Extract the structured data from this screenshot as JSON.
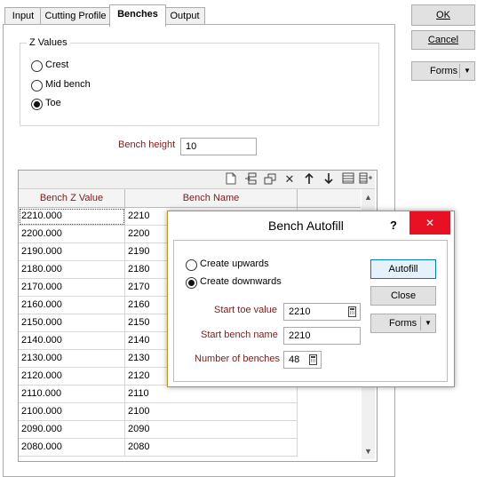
{
  "tabs": [
    "Input",
    "Cutting Profile",
    "Benches",
    "Output"
  ],
  "z_values": {
    "title": "Z Values",
    "options": [
      "Crest",
      "Mid bench",
      "Toe"
    ],
    "selected": "Toe"
  },
  "bench_height": {
    "label": "Bench height",
    "value": "10"
  },
  "grid": {
    "columns": [
      "Bench Z Value",
      "Bench Name"
    ],
    "rows": [
      [
        "2210.000",
        "2210"
      ],
      [
        "2200.000",
        "2200"
      ],
      [
        "2190.000",
        "2190"
      ],
      [
        "2180.000",
        "2180"
      ],
      [
        "2170.000",
        "2170"
      ],
      [
        "2160.000",
        "2160"
      ],
      [
        "2150.000",
        "2150"
      ],
      [
        "2140.000",
        "2140"
      ],
      [
        "2130.000",
        "2130"
      ],
      [
        "2120.000",
        "2120"
      ],
      [
        "2110.000",
        "2110"
      ],
      [
        "2100.000",
        "2100"
      ],
      [
        "2090.000",
        "2090"
      ],
      [
        "2080.000",
        "2080"
      ]
    ],
    "toolbar_icons": [
      "new-row-icon",
      "insert-row-icon",
      "copy-row-icon",
      "delete-row-icon",
      "move-up-icon",
      "move-down-icon",
      "table-icon",
      "add-column-icon"
    ]
  },
  "buttons": {
    "ok": "OK",
    "cancel": "Cancel",
    "forms": "Forms"
  },
  "dialog": {
    "title": "Bench Autofill",
    "help": "?",
    "close": "✕",
    "options": [
      "Create upwards",
      "Create downwards"
    ],
    "selected": "Create downwards",
    "fields": {
      "start_toe_label": "Start toe value",
      "start_toe_value": "2210",
      "start_bench_label": "Start bench name",
      "start_bench_value": "2210",
      "num_benches_label": "Number of benches",
      "num_benches_value": "48"
    },
    "buttons": {
      "autofill": "Autofill",
      "close": "Close",
      "forms": "Forms"
    }
  },
  "colors": {
    "label_red": "#7b1b1b",
    "close_button": "#e81123",
    "dialog_border": "#b8941b"
  }
}
